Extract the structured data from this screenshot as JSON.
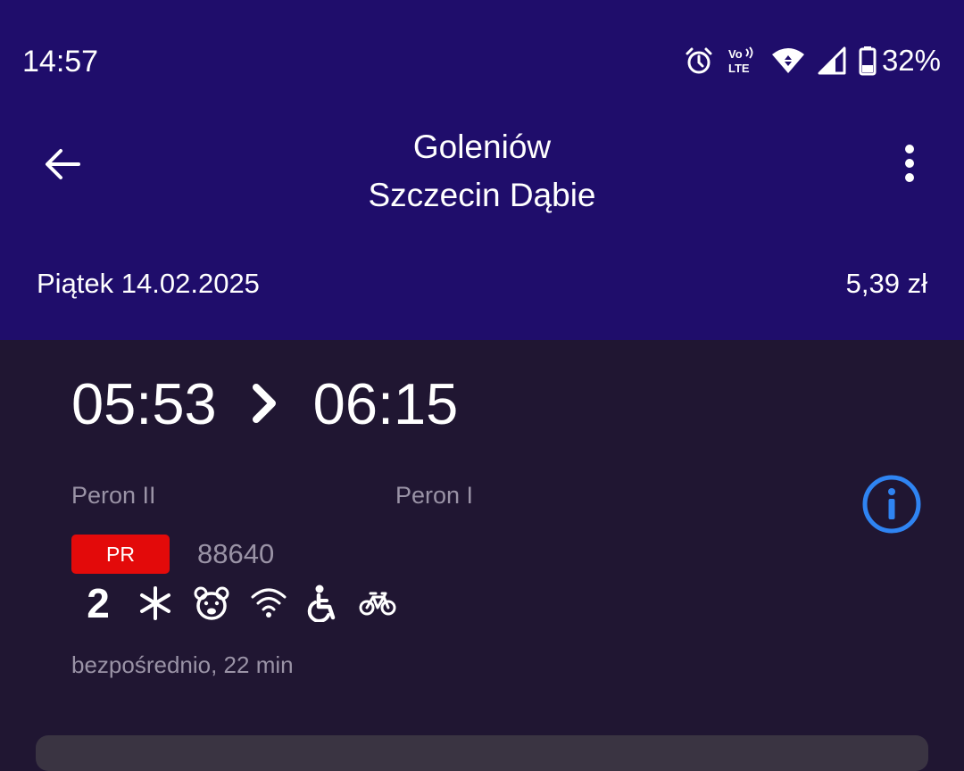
{
  "status_bar": {
    "time": "14:57",
    "battery": "32%",
    "icons": [
      "alarm-icon",
      "volte-icon",
      "wifi-icon",
      "cell-signal-icon",
      "battery-icon"
    ]
  },
  "app_bar": {
    "origin": "Goleniów",
    "destination": "Szczecin Dąbie",
    "back_icon": "arrow-back-icon",
    "menu_icon": "more-vert-icon"
  },
  "trip_summary": {
    "date": "Piątek 14.02.2025",
    "price": "5,39 zł"
  },
  "connection": {
    "departure_time": "05:53",
    "arrival_time": "06:15",
    "departure_platform": "Peron II",
    "arrival_platform": "Peron I",
    "carrier": "PR",
    "train_number": "88640",
    "class": "2",
    "amenities": [
      "air-conditioning-icon",
      "child-friendly-icon",
      "wifi-icon",
      "wheelchair-icon",
      "bicycle-icon"
    ],
    "duration": "bezpośrednio, 22 min",
    "info_icon": "info-icon"
  },
  "colors": {
    "header_bg": "#1f0d6b",
    "content_bg": "#201632",
    "carrier_badge": "#e30a0a",
    "info_accent": "#2f84f2",
    "muted_text": "#9a93a6"
  }
}
